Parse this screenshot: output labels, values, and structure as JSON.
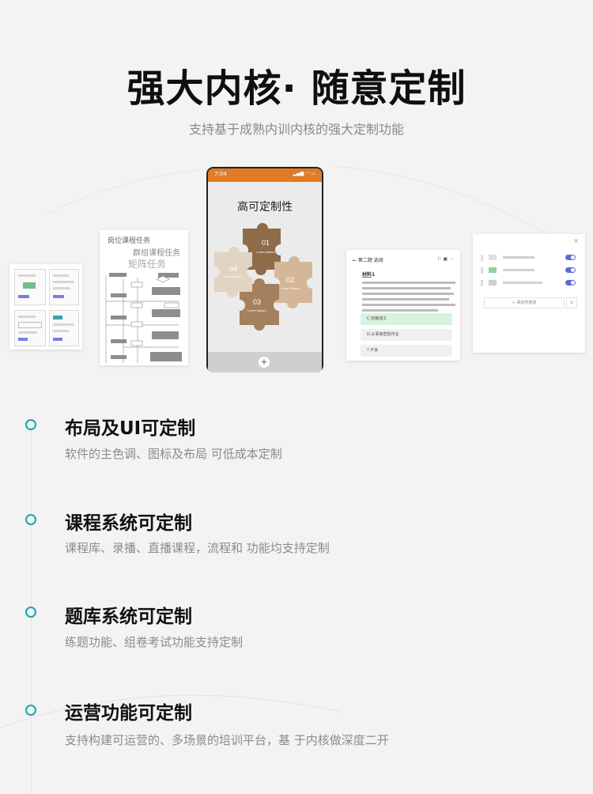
{
  "header": {
    "title": "强大内核· 随意定制",
    "subtitle": "支持基于成熟内训内核的强大定制功能"
  },
  "showcase": {
    "flow_card": {
      "line1": "岗位课程任务",
      "line2": "群组课程任务",
      "line3": "矩阵任务"
    },
    "phone": {
      "time": "7:04",
      "status": "▂▄▆ ◠ ▭",
      "title": "高可定制性",
      "plus": "+",
      "puzzle": [
        {
          "num": "01",
          "caption": "Lorem Ipsum"
        },
        {
          "num": "02",
          "caption": "Lorem Ipsum"
        },
        {
          "num": "03",
          "caption": "Lorem Ipsum"
        },
        {
          "num": "04",
          "caption": "Lorem Ipsum"
        }
      ],
      "colors": [
        "#8f6b4a",
        "#b88a63",
        "#d3b798",
        "#a5805e"
      ]
    },
    "quiz_card": {
      "header": "← 第二题 选择",
      "material": "材料1",
      "options": [
        {
          "key": "C",
          "text": "C.包装加工"
        },
        {
          "key": "D",
          "text": "D.从事高危险作业"
        },
        {
          "key": "?",
          "text": "?.不会"
        }
      ]
    },
    "settings_card": {
      "close": "×",
      "add_button": "+ 添加列表组"
    }
  },
  "features": [
    {
      "title": "布局及UI可定制",
      "desc": "软件的主色调、图标及布局 可低成本定制"
    },
    {
      "title": "课程系统可定制",
      "desc": "课程库、录播、直播课程，流程和 功能均支持定制"
    },
    {
      "title": "题库系统可定制",
      "desc": "练题功能、组卷考试功能支持定制"
    },
    {
      "title": "运营功能可定制",
      "desc": "支持构建可运营的、多场景的培训平台，基 于内核做深度二开"
    }
  ],
  "accent_color": "#1aa3b3"
}
